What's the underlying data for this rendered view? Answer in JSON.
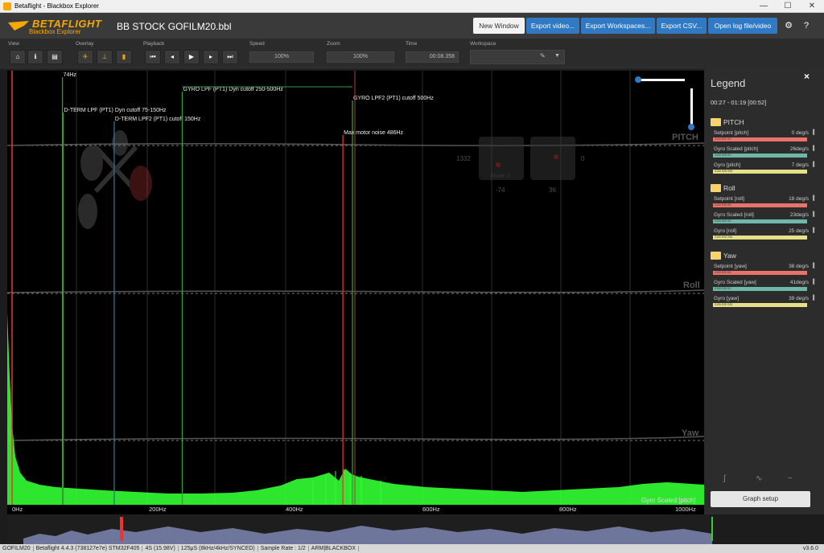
{
  "window": {
    "title": "Betaflight - Blackbox Explorer"
  },
  "header": {
    "logo_main": "BETAFLIGHT",
    "logo_sub": "Blackbox Explorer",
    "filename": "BB STOCK GOFILM20.bbl",
    "buttons": [
      "New Window",
      "Export video...",
      "Export Workspaces...",
      "Export CSV...",
      "Open log file/video"
    ]
  },
  "toolbar": {
    "labels": {
      "view": "View",
      "overlay": "Overlay",
      "playback": "Playback",
      "speed": "Speed",
      "zoom": "Zoom",
      "time": "Time",
      "workspace": "Workspace"
    },
    "speed_value": "100%",
    "zoom_value": "100%",
    "time_value": "00:08.358"
  },
  "graph": {
    "axis_labels": [
      "PITCH",
      "Roll",
      "Yaw"
    ],
    "markers": [
      {
        "label": "74Hz",
        "freq": 74
      },
      {
        "label": "D-TERM LPF (PT1) Dyn cutoff 75-150Hz",
        "freq": 75
      },
      {
        "label": "D-TERM LPF2 (PT1) cutoff 150Hz",
        "freq": 150
      },
      {
        "label": "GYRO LPF (PT1) Dyn cutoff 250-500Hz",
        "freq": 250
      },
      {
        "label": "GYRO LPF2 (PT1) cutoff 500Hz",
        "freq": 500
      },
      {
        "label": "Max motor noise 486Hz",
        "freq": 486
      }
    ],
    "x_ticks": [
      "0Hz",
      "200Hz",
      "400Hz",
      "600Hz",
      "800Hz",
      "1000Hz"
    ],
    "spectrum_label": "Gyro Scaled [pitch]",
    "sticks": {
      "left_top": "1332",
      "right_top": "0",
      "left_bottom": "-74",
      "right_bottom": "36",
      "mode": "Mode 2"
    }
  },
  "legend": {
    "title": "Legend",
    "close": "×",
    "range": "00:27 - 01:19 [00:52]",
    "groups": [
      {
        "name": "PITCH",
        "rows": [
          {
            "name": "Setpoint [pitch]",
            "value": "0 deg/s",
            "bar": "Z100 E20 S0",
            "color": "#e8736b"
          },
          {
            "name": "Gyro Scaled [pitch]",
            "value": "26deg/s",
            "bar": "Z100 E25 S0",
            "color": "#6fb8a9"
          },
          {
            "name": "Gyro [pitch]",
            "value": "7 deg/s",
            "bar": "Z100 E25 S30",
            "color": "#e5e08a"
          }
        ]
      },
      {
        "name": "Roll",
        "rows": [
          {
            "name": "Setpoint [roll]",
            "value": "18 deg/s",
            "bar": "Z100 E20 S0",
            "color": "#e8736b"
          },
          {
            "name": "Gyro Scaled [roll]",
            "value": "23deg/s",
            "bar": "Z100 E25 S0",
            "color": "#6fb8a9"
          },
          {
            "name": "Gyro [roll]",
            "value": "25 deg/s",
            "bar": "Z100 E25 S30",
            "color": "#e5e08a"
          }
        ]
      },
      {
        "name": "Yaw",
        "rows": [
          {
            "name": "Setpoint [yaw]",
            "value": "38 deg/s",
            "bar": "Z100 E20 S0",
            "color": "#e8736b"
          },
          {
            "name": "Gyro Scaled [yaw]",
            "value": "41deg/s",
            "bar": "Z100 E25 S0",
            "color": "#6fb8a9"
          },
          {
            "name": "Gyro [yaw]",
            "value": "39 deg/s",
            "bar": "Z100 E25 S30",
            "color": "#e5e08a"
          }
        ]
      }
    ],
    "graph_setup": "Graph setup"
  },
  "status": {
    "items": [
      "GOFILM20",
      "Betaflight 4.4.3 (738127e7e) STM32F405",
      "4S (15.98V)",
      "125μS (8kHz/4kHz/SYNCED)",
      "Sample Rate : 1/2",
      "ARM|BLACKBOX"
    ],
    "version": "v3.6.0"
  }
}
